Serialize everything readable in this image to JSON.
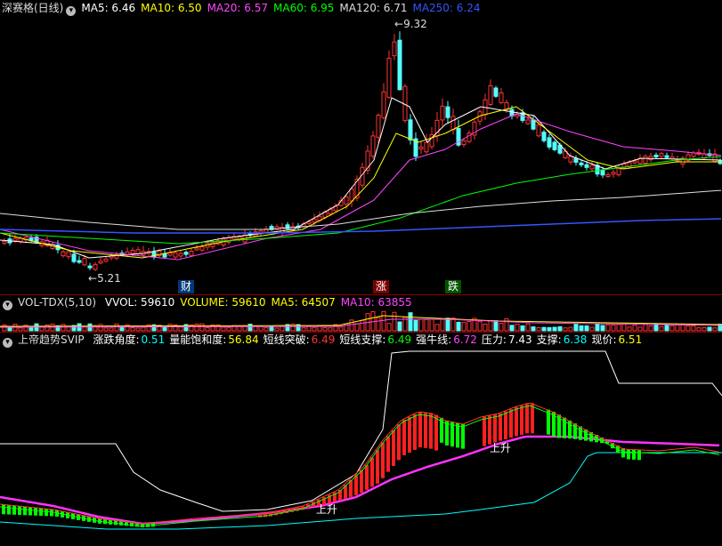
{
  "price_pane": {
    "stock_name": "深赛格(日线)",
    "ma": [
      {
        "label": "MA5: 6.46",
        "color": "#ffffff"
      },
      {
        "label": "MA10: 6.50",
        "color": "#ffff00"
      },
      {
        "label": "MA20: 6.57",
        "color": "#ff44ff"
      },
      {
        "label": "MA60: 6.95",
        "color": "#00ff00"
      },
      {
        "label": "MA120: 6.71",
        "color": "#dddddd"
      },
      {
        "label": "MA250: 6.24",
        "color": "#3355ff"
      }
    ],
    "high_label": "9.32",
    "low_label": "5.21",
    "markers": [
      {
        "text": "财",
        "bg": "#003a7a",
        "color": "#ffffff"
      },
      {
        "text": "涨",
        "bg": "#7a0000",
        "color": "#ffffff"
      },
      {
        "text": "跌",
        "bg": "#005500",
        "color": "#ffffff"
      }
    ]
  },
  "vol_pane": {
    "title": "VOL-TDX(5,10)",
    "items": [
      {
        "label": "VVOL: 59610",
        "color": "#ffffff"
      },
      {
        "label": "VOLUME: 59610",
        "color": "#ffff00"
      },
      {
        "label": "MA5: 64507",
        "color": "#ffff00"
      },
      {
        "label": "MA10: 63855",
        "color": "#ff44ff"
      }
    ]
  },
  "ind_pane": {
    "title": "上帝趋势SVIP",
    "items": [
      {
        "name": "涨跌角度:",
        "value": "0.51",
        "color": "#00ffff"
      },
      {
        "name": "量能饱和度:",
        "value": "56.84",
        "color": "#ffff00"
      },
      {
        "name": "短线突破:",
        "value": "6.49",
        "color": "#ff3333"
      },
      {
        "name": "短线支撑:",
        "value": "6.49",
        "color": "#00ff00"
      },
      {
        "name": "强牛线:",
        "value": "6.72",
        "color": "#ff44ff"
      },
      {
        "name": "压力:",
        "value": "7.43",
        "color": "#ffffff"
      },
      {
        "name": "支撑:",
        "value": "6.38",
        "color": "#00ffff"
      },
      {
        "name": "现价:",
        "value": "6.51",
        "color": "#ffff00"
      }
    ],
    "rise_label_1": "上升",
    "rise_label_2": "上升"
  },
  "colors": {
    "up": "#ff3333",
    "down": "#54ffff",
    "grid": "#8b0000",
    "bg": "#000000"
  }
}
